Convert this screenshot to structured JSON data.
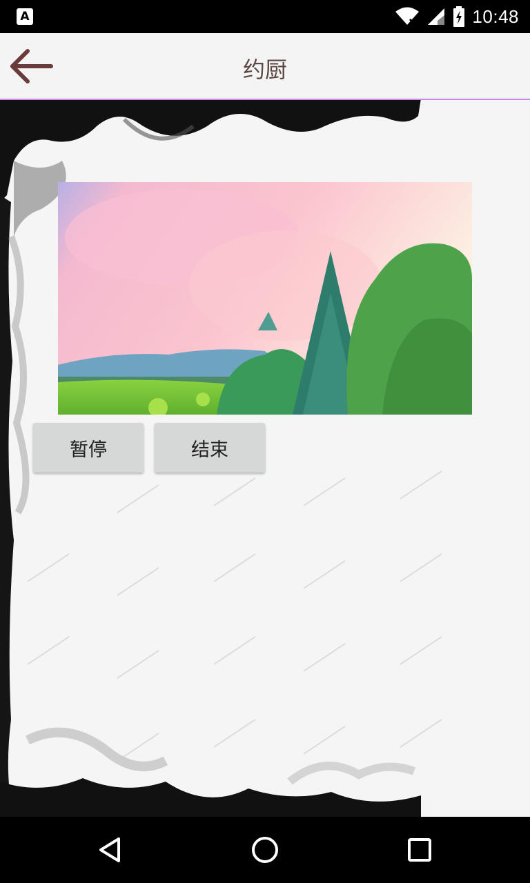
{
  "status_bar": {
    "app_icon_label": "A",
    "time": "10:48",
    "icons": [
      "app-notification-icon",
      "wifi-icon",
      "cell-signal-icon",
      "battery-charging-icon"
    ]
  },
  "app_bar": {
    "title": "约厨",
    "back_icon": "arrow-back-icon"
  },
  "video": {
    "icon": "video-player"
  },
  "controls": {
    "pause_label": "暂停",
    "stop_label": "结束"
  },
  "nav_bar": {
    "icons": [
      "back-triangle-icon",
      "home-circle-icon",
      "recents-square-icon"
    ]
  },
  "colors": {
    "status_bar": "#000000",
    "app_bar_bg": "#f4f4f4",
    "app_bar_divider": "#c98ce0",
    "title_text": "#5b4641",
    "back_arrow": "#6b3a3a",
    "button_bg": "#d6d7d7",
    "page_bg": "#f5f5f5"
  }
}
